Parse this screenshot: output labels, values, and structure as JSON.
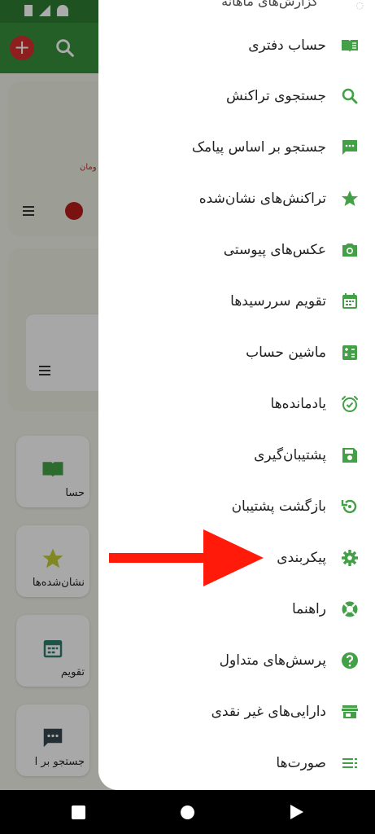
{
  "app_bar": {
    "add_icon": "plus-circle-icon",
    "search_icon": "search-icon"
  },
  "background": {
    "partial_text": "ومان",
    "quick_tiles": [
      {
        "label": "حسا",
        "icon": "book-icon"
      },
      {
        "label": "نشان‌شده‌ها",
        "icon": "star-icon"
      },
      {
        "label": "تقویم",
        "icon": "calendar-icon"
      },
      {
        "label": "جستجو بر ا",
        "icon": "message-icon"
      }
    ]
  },
  "drawer": {
    "top_partial_text": "گزارش‌های ماهانه",
    "items": [
      {
        "label": "حساب دفتری",
        "icon": "book-icon"
      },
      {
        "label": "جستجوی تراکنش",
        "icon": "search-icon"
      },
      {
        "label": "جستجو بر اساس پیامک",
        "icon": "message-icon"
      },
      {
        "label": "تراکنش‌های نشان‌شده",
        "icon": "star-icon"
      },
      {
        "label": "عکس‌های پیوستی",
        "icon": "camera-icon"
      },
      {
        "label": "تقویم سررسیدها",
        "icon": "calendar-icon"
      },
      {
        "label": "ماشین حساب",
        "icon": "calculator-icon"
      },
      {
        "label": "یادمانده‌ها",
        "icon": "alarm-icon"
      },
      {
        "label": "پشتیبان‌گیری",
        "icon": "save-icon"
      },
      {
        "label": "بازگشت پشتیبان",
        "icon": "restore-icon"
      },
      {
        "label": "پیکربندی",
        "icon": "gear-icon"
      },
      {
        "label": "راهنما",
        "icon": "lifebuoy-icon"
      },
      {
        "label": "پرسش‌های متداول",
        "icon": "help-icon"
      },
      {
        "label": "دارایی‌های غیر نقدی",
        "icon": "store-icon"
      },
      {
        "label": "صورت‌ها",
        "icon": "list-icon"
      }
    ]
  },
  "colors": {
    "accent": "#43a047",
    "arrow": "#ff1a0a",
    "appbar": "#388e3c"
  }
}
